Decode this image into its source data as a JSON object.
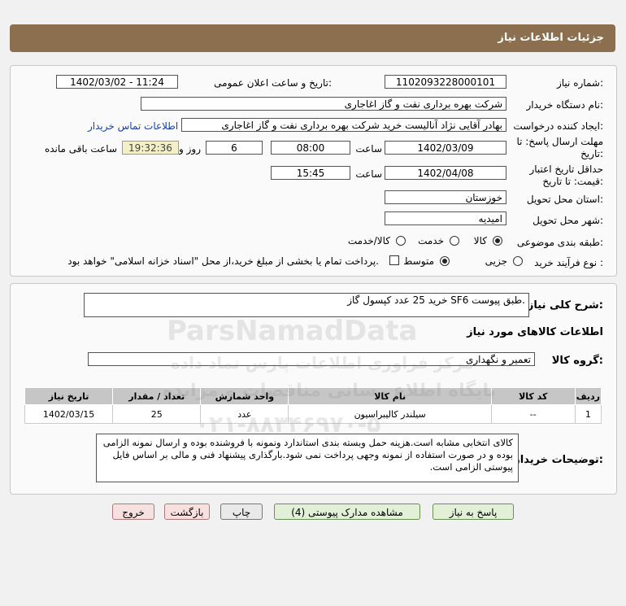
{
  "header": {
    "title": "جزئیات اطلاعات نیاز"
  },
  "fields": {
    "need_number_label": "شماره نیاز:",
    "need_number": "1102093228000101",
    "announce_label": "تاریخ و ساعت اعلان عمومی:",
    "announce_value": "1402/03/02 - 11:24",
    "buyer_org_label": "نام دستگاه خریدار:",
    "buyer_org": "شرکت بهره برداری نفت و گاز اغاجاری",
    "requester_label": "ایجاد کننده درخواست:",
    "requester": "بهادر  آقایی نژاد آنالیست خرید شرکت بهره برداری نفت و گاز اغاجاری",
    "contact_link": "اطلاعات تماس خریدار",
    "deadline_label_1": "مهلت ارسال پاسخ: تا",
    "deadline_label_2": "تاریخ:",
    "deadline_date": "1402/03/09",
    "time_label": "ساعت",
    "deadline_time": "08:00",
    "days": "6",
    "days_label": "روز و",
    "countdown": "19:32:36",
    "remaining_label": "ساعت باقی مانده",
    "validity_label_1": "حداقل تاریخ اعتبار",
    "validity_label_2": "قیمت: تا تاریخ:",
    "validity_date": "1402/04/08",
    "validity_time": "15:45",
    "province_label": "استان محل تحویل:",
    "province": "خوزستان",
    "city_label": "شهر محل تحویل:",
    "city": "امیدیه",
    "category_label": "طبقه بندی موضوعی:",
    "category_options": [
      "کالا",
      "خدمت",
      "کالا/خدمت"
    ],
    "process_label": "نوع فرآیند خرید :",
    "process_options": [
      "جزیی",
      "متوسط"
    ],
    "payment_note": "پرداخت تمام یا بخشی از مبلغ خرید،از محل \"اسناد خزانه اسلامی\" خواهد بود."
  },
  "details": {
    "summary_label": "شرح کلی نیاز:",
    "summary": "خرید 25 عدد کپسول گاز SF6 طبق پیوست.",
    "goods_info_title": "اطلاعات کالاهای مورد نیاز",
    "goods_group_label": "گروه کالا:",
    "goods_group": "تعمیر و نگهداری",
    "table": {
      "headers": [
        "ردیف",
        "کد کالا",
        "نام کالا",
        "واحد شمارش",
        "تعداد / مقدار",
        "تاریخ نیاز"
      ],
      "rows": [
        [
          "1",
          "--",
          "سیلندر کالیبراسیون",
          "عدد",
          "25",
          "1402/03/15"
        ]
      ]
    },
    "buyer_notes_label": "توضیحات خریدار:",
    "buyer_notes": "کالای انتخابی مشابه است.هزینه حمل وبسته بندی استاندارد ونمونه با فروشنده بوده و ارسال نمونه الزامی بوده و در صورت استفاده از نمونه وجهی پرداخت نمی شود.بارگذاری پیشنهاد فنی و مالی بر اساس فایل پیوستی الزامی است."
  },
  "buttons": {
    "reply": "پاسخ به نیاز",
    "attachments": "مشاهده مدارک پیوستی (4)",
    "print": "چاپ",
    "back": "بازگشت",
    "exit": "خروج"
  },
  "watermark": {
    "brand": "ParsNamadData",
    "line1": "مرکز فراوری اطلاعات پارس نماد داده",
    "line2": "پایگاه اطلاع رسانی مناقصات و مزایده",
    "phone": "۰۲۱-۸۸۳۴۶۹۷۰-۵"
  }
}
